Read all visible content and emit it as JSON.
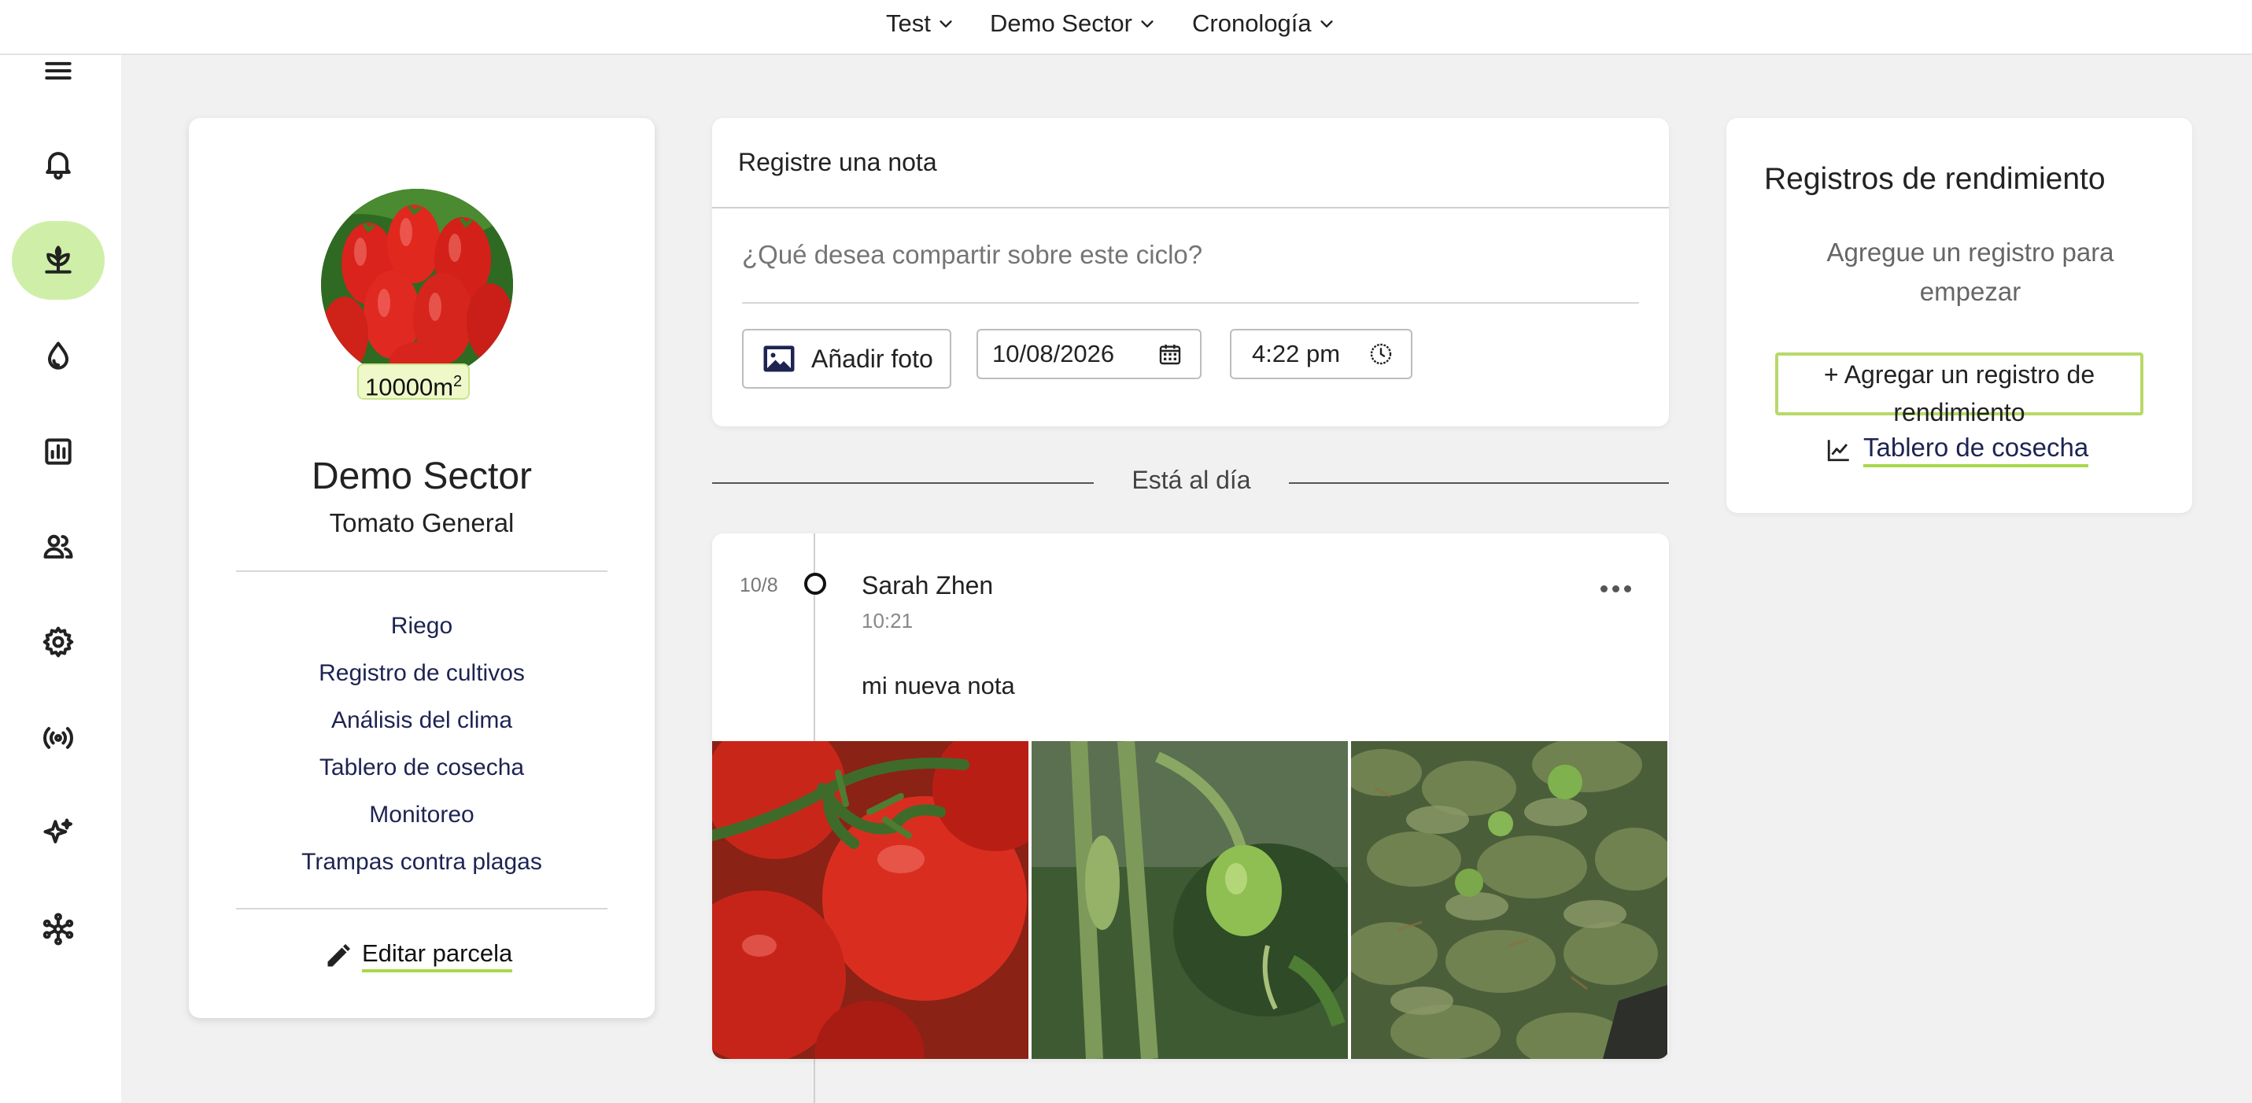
{
  "topbar": {
    "menus": [
      {
        "label": "Test"
      },
      {
        "label": "Demo Sector"
      },
      {
        "label": "Cronología"
      }
    ]
  },
  "sidebar": {
    "items": [
      {
        "icon": "menu-icon"
      },
      {
        "icon": "bell-icon"
      },
      {
        "icon": "plant-icon",
        "active": true
      },
      {
        "icon": "water-drop-icon"
      },
      {
        "icon": "bar-chart-icon"
      },
      {
        "icon": "users-icon"
      },
      {
        "icon": "gear-icon"
      },
      {
        "icon": "signal-icon"
      },
      {
        "icon": "sparkles-icon"
      },
      {
        "icon": "network-icon"
      }
    ],
    "active_color": "#cfefa8"
  },
  "plot": {
    "area_value": "10000m",
    "area_exp": "2",
    "sector_name": "Demo Sector",
    "crop": "Tomato General",
    "links": [
      "Riego",
      "Registro de cultivos",
      "Análisis del clima",
      "Tablero de cosecha",
      "Monitoreo",
      "Trampas contra plagas"
    ],
    "edit_label": "Editar parcela"
  },
  "note": {
    "title": "Registre una nota",
    "placeholder": "¿Qué desea compartir sobre este ciclo?",
    "add_photo_label": "Añadir foto",
    "date": "10/08/2026",
    "time": "4:22 pm"
  },
  "feed": {
    "status_label": "Está al día",
    "entry": {
      "date": "10/8",
      "author": "Sarah Zhen",
      "time": "10:21",
      "text": "mi nueva nota"
    }
  },
  "performance": {
    "title": "Registros de rendimiento",
    "hint": "Agregue un registro para empezar",
    "add_button_label": "+ Agregar un registro de rendimiento",
    "harvest_link_label": "Tablero de cosecha"
  },
  "colors": {
    "accent_green": "#a8d84a",
    "link_navy": "#1d2452"
  }
}
